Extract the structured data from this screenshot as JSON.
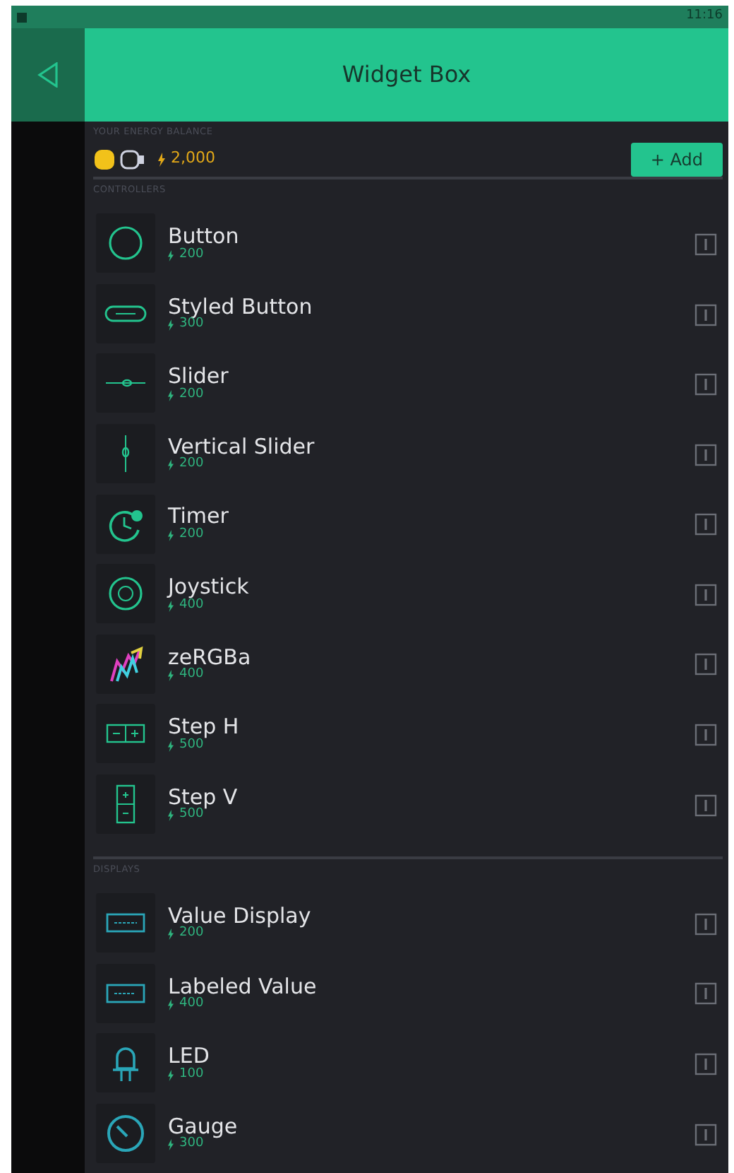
{
  "status_bar": {
    "time": "11:16"
  },
  "header": {
    "title": "Widget Box"
  },
  "energy": {
    "label": "YOUR ENERGY BALANCE",
    "amount": "2,000",
    "add_button": "+ Add"
  },
  "sections": [
    {
      "title": "CONTROLLERS",
      "items": [
        {
          "name": "Button",
          "price": "200",
          "kind": "button"
        },
        {
          "name": "Styled Button",
          "price": "300",
          "kind": "styled"
        },
        {
          "name": "Slider",
          "price": "200",
          "kind": "slider"
        },
        {
          "name": "Vertical Slider",
          "price": "200",
          "kind": "vslider"
        },
        {
          "name": "Timer",
          "price": "200",
          "kind": "timer"
        },
        {
          "name": "Joystick",
          "price": "400",
          "kind": "joystick"
        },
        {
          "name": "zeRGBa",
          "price": "400",
          "kind": "zergba"
        },
        {
          "name": "Step H",
          "price": "500",
          "kind": "steph"
        },
        {
          "name": "Step V",
          "price": "500",
          "kind": "stepv"
        }
      ]
    },
    {
      "title": "DISPLAYS",
      "items": [
        {
          "name": "Value Display",
          "price": "200",
          "kind": "value"
        },
        {
          "name": "Labeled Value",
          "price": "400",
          "kind": "labeled"
        },
        {
          "name": "LED",
          "price": "100",
          "kind": "led"
        },
        {
          "name": "Gauge",
          "price": "300",
          "kind": "gauge"
        }
      ]
    }
  ]
}
